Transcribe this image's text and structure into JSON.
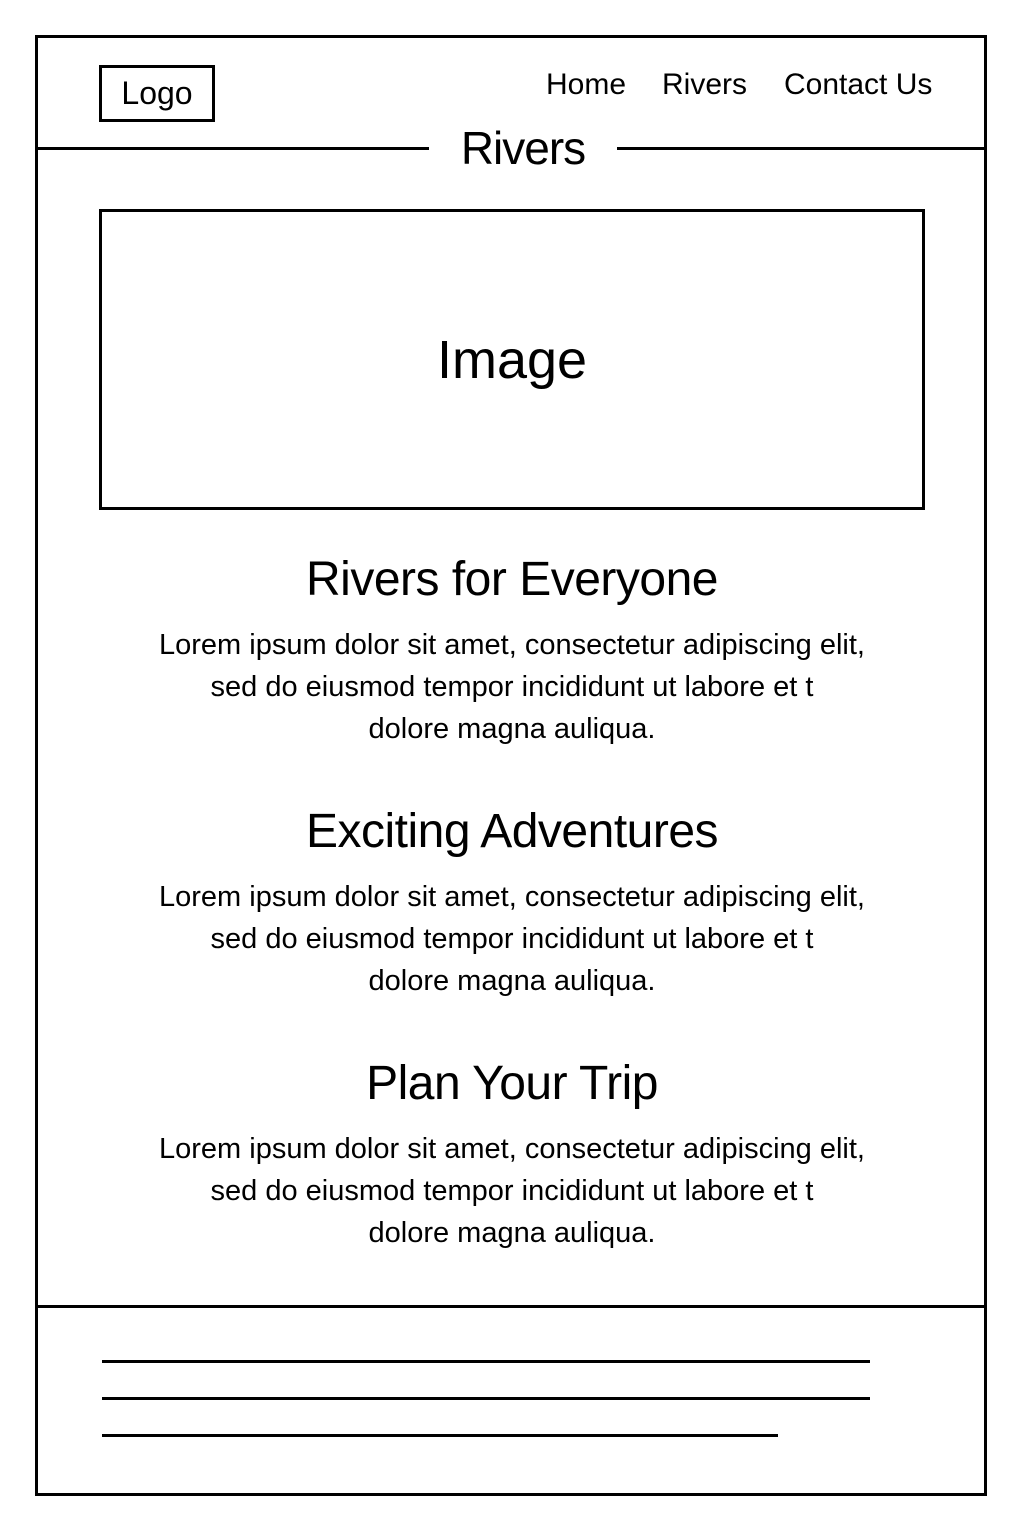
{
  "header": {
    "logo_label": "Logo",
    "nav": {
      "home": "Home",
      "rivers": "Rivers",
      "contact": "Contact Us"
    }
  },
  "page_title": "Rivers",
  "hero": {
    "image_label": "Image"
  },
  "sections": [
    {
      "heading": "Rivers for Everyone",
      "body": "Lorem ipsum dolor sit amet, consectetur adipiscing elit,\nsed do eiusmod tempor incididunt ut labore et t\ndolore magna auliqua."
    },
    {
      "heading": "Exciting Adventures",
      "body": "Lorem ipsum dolor sit amet, consectetur adipiscing elit,\nsed do eiusmod tempor incididunt ut labore et t\ndolore magna auliqua."
    },
    {
      "heading": "Plan Your Trip",
      "body": "Lorem ipsum dolor sit amet, consectetur adipiscing elit,\nsed do eiusmod tempor incididunt ut labore et t\ndolore magna auliqua."
    }
  ]
}
